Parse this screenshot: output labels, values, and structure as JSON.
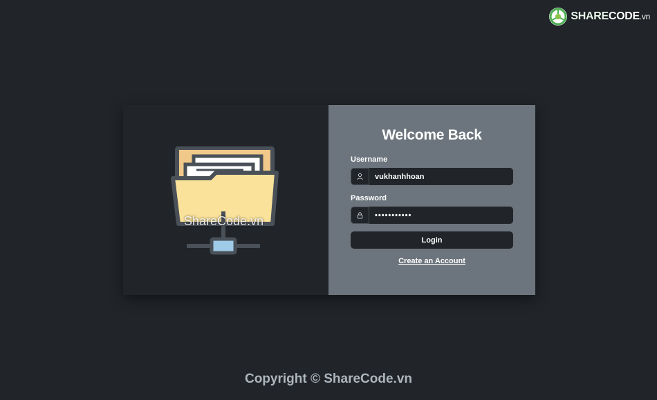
{
  "brand": {
    "logo_share": "SHARE",
    "logo_code": "CODE",
    "logo_vn": ".vn",
    "icon": "sharecode-logo-icon"
  },
  "illustration": {
    "icon": "folder-network-icon",
    "watermark": "ShareCode.vn"
  },
  "form": {
    "title": "Welcome Back",
    "username_label": "Username",
    "username_value": "vukhanhhoan",
    "username_icon": "user-icon",
    "password_label": "Password",
    "password_value": "•••••••••••",
    "password_icon": "lock-icon",
    "login_label": "Login",
    "create_account_label": "Create an Account"
  },
  "footer": {
    "copyright": "Copyright © ShareCode.vn"
  },
  "colors": {
    "background": "#212529",
    "panel": "#6c757d",
    "input_bg": "#212529",
    "text": "#ffffff",
    "footer_text": "#adb5bd",
    "folder_fill": "#fae29a",
    "folder_outline": "#495057",
    "network_node": "#9fcbe8"
  }
}
